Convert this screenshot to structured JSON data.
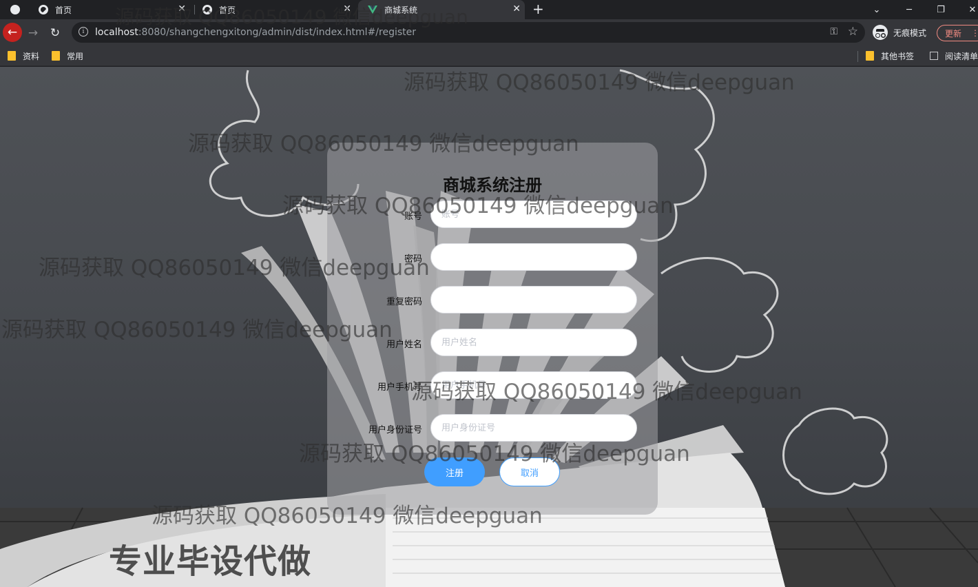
{
  "browser": {
    "tabs": [
      {
        "label": "首页",
        "active": false
      },
      {
        "label": "首页",
        "active": false
      },
      {
        "label": "商城系统",
        "active": true
      }
    ],
    "url_host": "localhost",
    "url_rest": ":8080/shangchengxitong/admin/dist/index.html#/register",
    "incognito_label": "无痕模式",
    "update_label": "更新",
    "bookmarks": [
      {
        "label": "资料",
        "icon": "folder-icon"
      },
      {
        "label": "常用",
        "icon": "folder-icon"
      }
    ],
    "other_bookmarks": "其他书签",
    "reading_list": "阅读清单"
  },
  "form": {
    "title": "商城系统注册",
    "fields": [
      {
        "label": "账号",
        "placeholder": "账号",
        "type": "text"
      },
      {
        "label": "密码",
        "placeholder": "",
        "type": "password"
      },
      {
        "label": "重复密码",
        "placeholder": "",
        "type": "password"
      },
      {
        "label": "用户姓名",
        "placeholder": "用户姓名",
        "type": "text"
      },
      {
        "label": "用户手机号",
        "placeholder": "用户手机号",
        "type": "text"
      },
      {
        "label": "用户身份证号",
        "placeholder": "用户身份证号",
        "type": "text"
      }
    ],
    "register_label": "注册",
    "cancel_label": "取消"
  },
  "watermark": {
    "text": "源码获取 QQ86050149 微信deepguan",
    "big": "专业毕设代做"
  },
  "colors": {
    "accent": "#409eff",
    "back_button": "#c5221f",
    "chrome_dark": "#202124",
    "chrome_toolbar": "#35363a"
  }
}
